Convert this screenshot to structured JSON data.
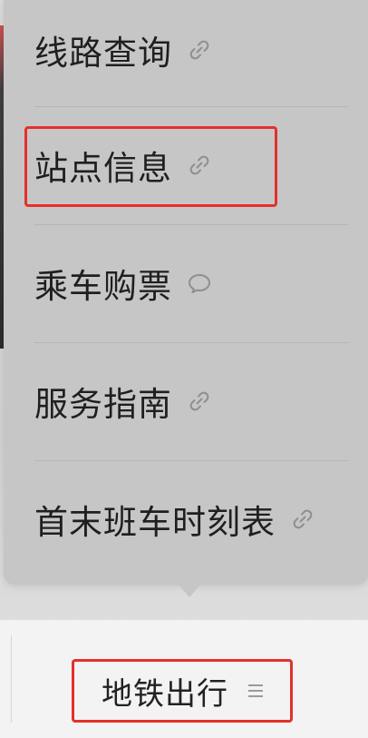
{
  "menu": {
    "items": [
      {
        "label": "线路查询",
        "icon": "link-icon"
      },
      {
        "label": "站点信息",
        "icon": "link-icon"
      },
      {
        "label": "乘车购票",
        "icon": "chat-bubble-icon"
      },
      {
        "label": "服务指南",
        "icon": "link-icon"
      },
      {
        "label": "首末班车时刻表",
        "icon": "link-icon"
      }
    ]
  },
  "bottom_tab": {
    "label": "地铁出行",
    "icon": "hamburger-menu-icon"
  },
  "colors": {
    "highlight_border": "#e5302c",
    "popover_bg": "#c6c6c6",
    "text": "#1f1f1f"
  }
}
